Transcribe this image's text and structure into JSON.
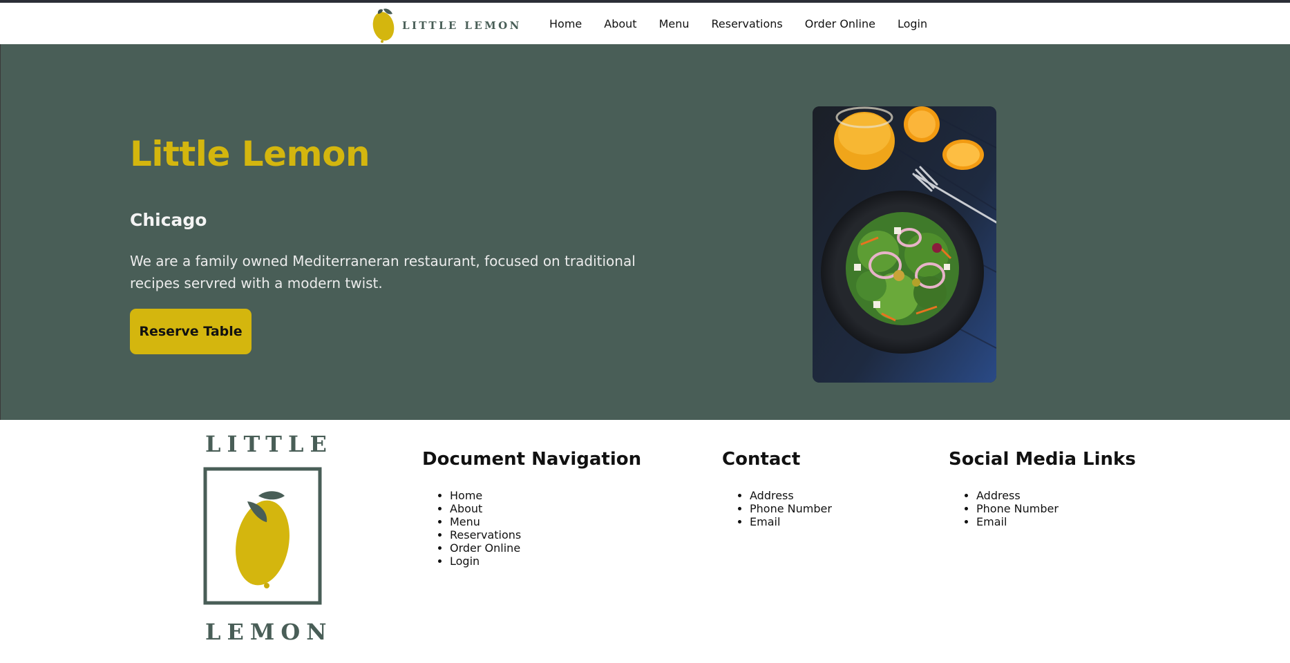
{
  "header": {
    "brand": "LITTLE LEMON",
    "nav": [
      "Home",
      "About",
      "Menu",
      "Reservations",
      "Order Online",
      "Login"
    ]
  },
  "hero": {
    "title": "Little Lemon",
    "city": "Chicago",
    "description": "We are a family owned Mediterraneran restaurant, focused on traditional recipes servred with a modern twist.",
    "cta_label": "Reserve Table",
    "image": "salad-and-orange-juice-photo"
  },
  "footer": {
    "logo_top": "LITTLE",
    "logo_bottom": "LEMON",
    "columns": [
      {
        "title": "Document Navigation",
        "items": [
          "Home",
          "About",
          "Menu",
          "Reservations",
          "Order Online",
          "Login"
        ]
      },
      {
        "title": "Contact",
        "items": [
          "Address",
          "Phone Number",
          "Email"
        ]
      },
      {
        "title": "Social Media Links",
        "items": [
          "Address",
          "Phone Number",
          "Email"
        ]
      }
    ]
  },
  "colors": {
    "primary_green": "#495e57",
    "primary_yellow": "#d4b60e",
    "text_light": "#ececec"
  }
}
